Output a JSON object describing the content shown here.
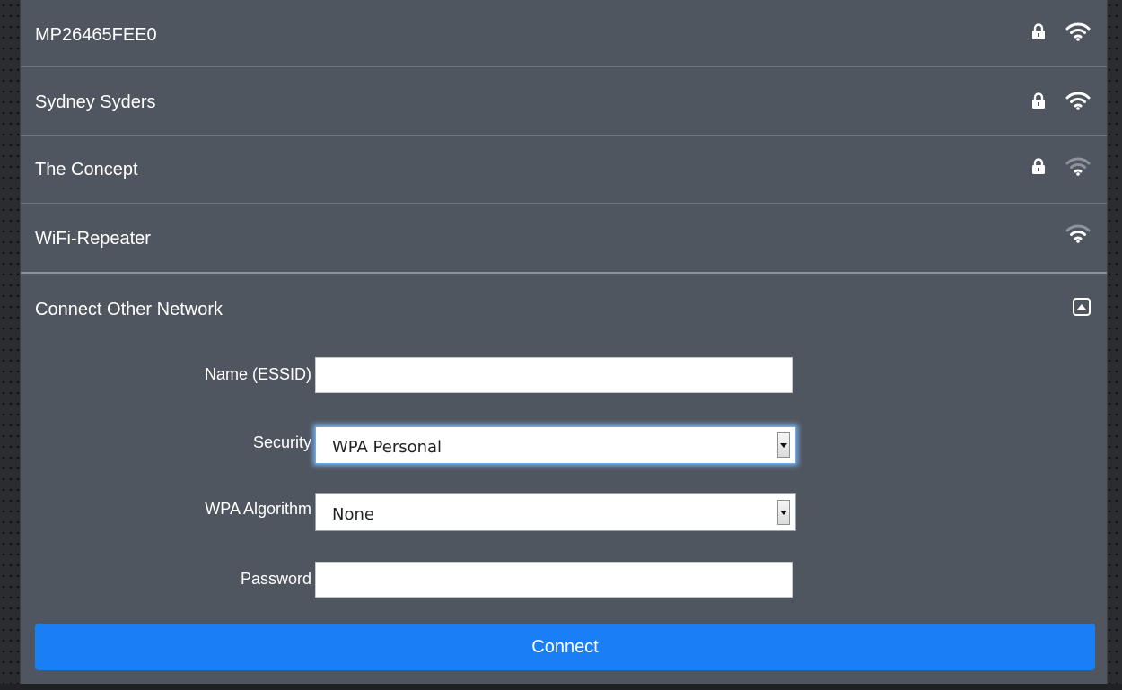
{
  "networks": [
    {
      "name": "MP26465FEE0",
      "secured": true,
      "signal": "full"
    },
    {
      "name": "Sydney Syders",
      "secured": true,
      "signal": "full"
    },
    {
      "name": "The Concept",
      "secured": true,
      "signal": "weak"
    },
    {
      "name": "WiFi-Repeater",
      "secured": false,
      "signal": "medium"
    }
  ],
  "other_network": {
    "title": "Connect Other Network",
    "collapse_icon": "collapse-up-icon",
    "name_label": "Name (ESSID)",
    "name_value": "",
    "security_label": "Security",
    "security_value": "WPA Personal",
    "algorithm_label": "WPA Algorithm",
    "algorithm_value": "None",
    "password_label": "Password",
    "password_value": "",
    "connect_label": "Connect"
  },
  "colors": {
    "panel": "#4f565f",
    "accent": "#1a7ef5",
    "text": "#ffffff"
  },
  "icons": [
    "lock-icon",
    "wifi-icon"
  ]
}
